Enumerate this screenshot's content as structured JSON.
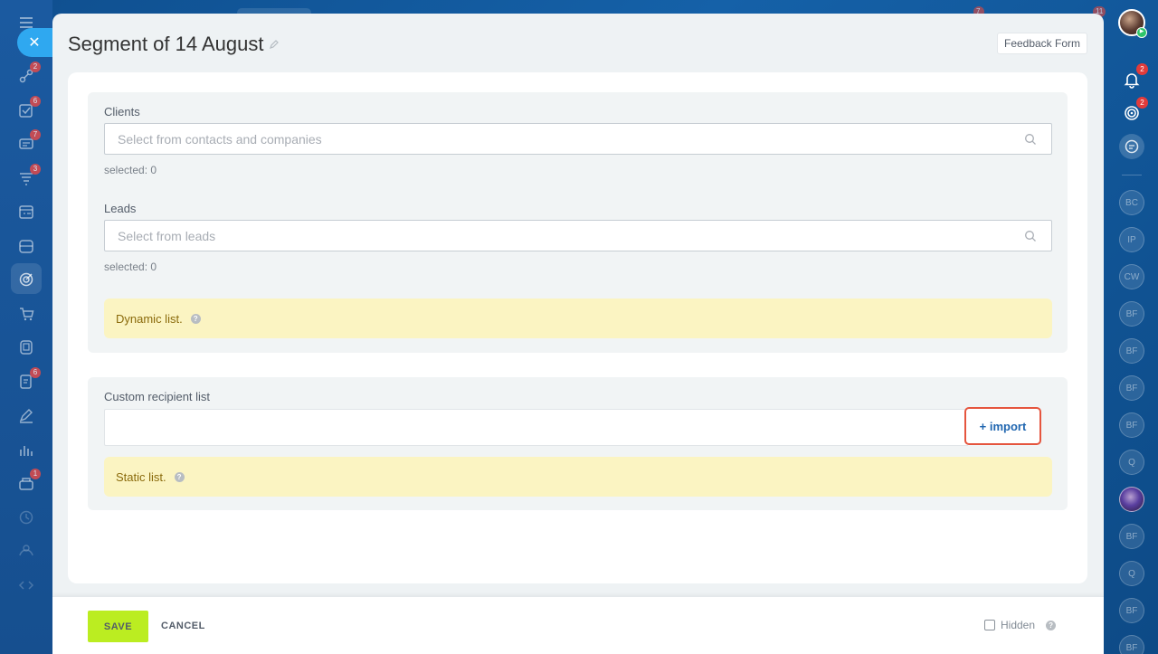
{
  "panel": {
    "title": "Segment of 14 August",
    "feedback_label": "Feedback Form"
  },
  "clients": {
    "label": "Clients",
    "placeholder": "Select from contacts and companies",
    "selected_text": "selected:  0"
  },
  "leads": {
    "label": "Leads",
    "placeholder": "Select from leads",
    "selected_text": "selected:  0"
  },
  "dynamic_notice": "Dynamic list.",
  "custom": {
    "label": "Custom recipient list",
    "import_label": "+ import"
  },
  "static_notice": "Static list.",
  "footer": {
    "save_label": "SAVE",
    "cancel_label": "CANCEL",
    "hidden_label": "Hidden"
  },
  "left_rail_badges": [
    "2",
    "6",
    "7",
    "3",
    "6",
    "1"
  ],
  "top_badges": [
    "7",
    "11"
  ],
  "right_rail": {
    "bell_badge": "2",
    "target_badge": "2",
    "avatars": [
      "BC",
      "IP",
      "CW",
      "BF",
      "BF",
      "BF",
      "BF",
      "Q",
      "",
      "BF",
      "Q",
      "BF",
      "BF"
    ]
  },
  "colors": {
    "accent_green": "#bbed21",
    "import_outline": "#e5553e",
    "link_blue": "#2066b0",
    "notice_bg": "#fbf4c2"
  }
}
